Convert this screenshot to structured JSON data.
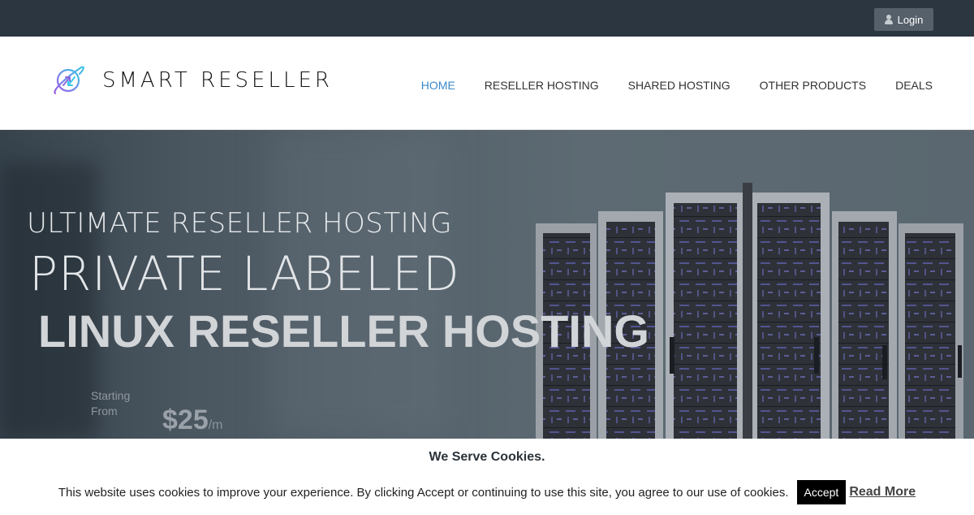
{
  "topbar": {
    "login_label": "Login",
    "login_icon": "user-icon"
  },
  "header": {
    "logo_text": "SMART RESELLER",
    "logo_icon": "globe-arrows-icon",
    "nav": [
      {
        "label": "HOME",
        "active": true
      },
      {
        "label": "RESELLER HOSTING",
        "active": false
      },
      {
        "label": "SHARED HOSTING",
        "active": false
      },
      {
        "label": "OTHER PRODUCTS",
        "active": false
      },
      {
        "label": "DEALS",
        "active": false
      }
    ],
    "active_color": "#3a89c9"
  },
  "hero": {
    "line1": "ULTIMATE RESELLER HOSTING",
    "line2": "PRIVATE LABELED",
    "line3": "LINUX RESELLER HOSTING",
    "starting_line1": "Starting",
    "starting_line2": "From",
    "price": "$25",
    "price_period": "/m",
    "image": "server-racks"
  },
  "cookie_banner": {
    "title": "We Serve Cookies.",
    "message": "This website uses cookies to improve your experience. By clicking Accept or continuing to use this site, you agree to our use of cookies.",
    "accept_label": "Accept",
    "read_more_label": "Read More"
  }
}
